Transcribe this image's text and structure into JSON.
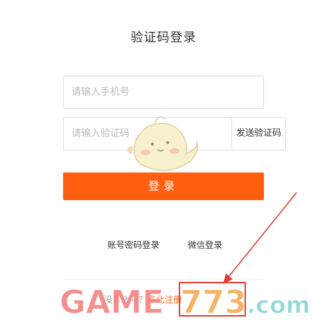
{
  "title": "验证码登录",
  "phone": {
    "placeholder": "请输入手机号",
    "value": ""
  },
  "code": {
    "placeholder": "请输入验证码",
    "value": ""
  },
  "send_code_label": "发送验证码",
  "login_label": "登录",
  "alt_login": {
    "password_label": "账号密码登录",
    "wechat_label": "微信登录"
  },
  "register": {
    "prompt": "没有账号？",
    "link": "点此注册"
  },
  "watermark": {
    "text": "GAME773.com"
  },
  "colors": {
    "accent": "#ff5f0f",
    "annotation": "#e53a2e",
    "border": "#dcdcdc"
  },
  "icons": [
    "mascot-icon",
    "arrow-annotation"
  ]
}
